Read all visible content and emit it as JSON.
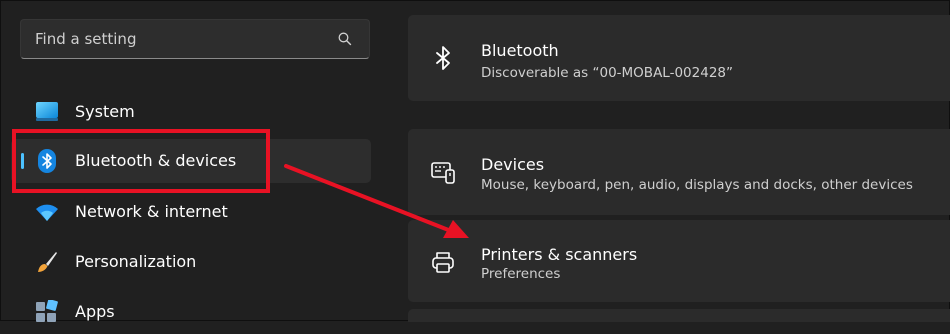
{
  "search": {
    "placeholder": "Find a setting"
  },
  "sidebar": {
    "items": [
      {
        "label": "System",
        "icon": "monitor-icon"
      },
      {
        "label": "Bluetooth & devices",
        "icon": "bluetooth-icon",
        "selected": true
      },
      {
        "label": "Network & internet",
        "icon": "wifi-icon"
      },
      {
        "label": "Personalization",
        "icon": "paintbrush-icon"
      },
      {
        "label": "Apps",
        "icon": "apps-icon"
      }
    ]
  },
  "cards": [
    {
      "title": "Bluetooth",
      "subtitle": "Discoverable as “00-MOBAL-002428”",
      "icon": "bluetooth-icon"
    },
    {
      "title": "Devices",
      "subtitle": "Mouse, keyboard, pen, audio, displays and docks, other devices",
      "icon": "devices-icon"
    },
    {
      "title": "Printers & scanners",
      "subtitle": "Preferences",
      "icon": "printer-icon"
    }
  ],
  "colors": {
    "background": "#202020",
    "card": "#2b2b2b",
    "accent": "#4cc2ff",
    "annotation": "#e81224"
  }
}
